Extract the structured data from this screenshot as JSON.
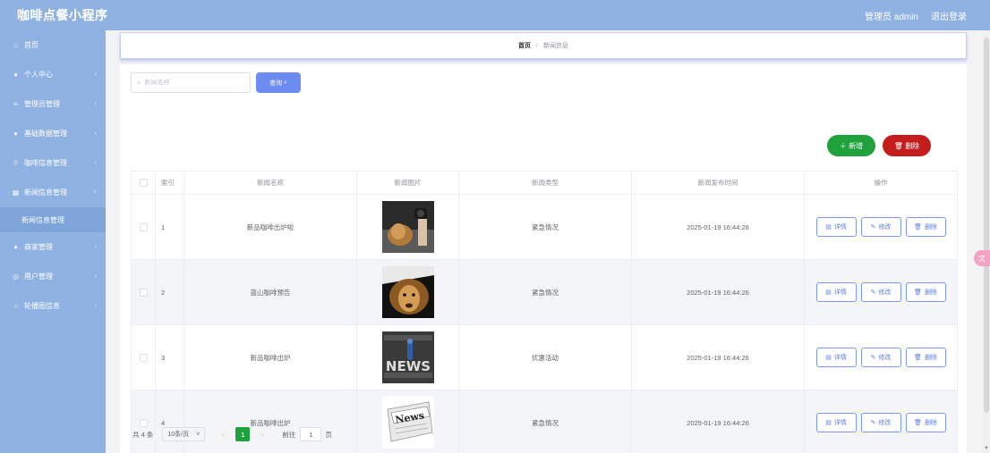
{
  "app": {
    "title": "咖啡点餐小程序"
  },
  "header": {
    "user_label": "管理员 admin",
    "logout_label": "退出登录"
  },
  "sidebar": {
    "items": [
      {
        "label": "首页",
        "icon": "home-icon"
      },
      {
        "label": "个人中心",
        "icon": "user-icon"
      },
      {
        "label": "管理员管理",
        "icon": "settings-icon"
      },
      {
        "label": "基础数据管理",
        "icon": "user-icon"
      },
      {
        "label": "咖啡信息管理",
        "icon": "cup-icon"
      },
      {
        "label": "新闻信息管理",
        "icon": "grid-icon"
      },
      {
        "label": "新闻信息管理",
        "icon": ""
      },
      {
        "label": "商家管理",
        "icon": "user-icon"
      },
      {
        "label": "用户管理",
        "icon": "circle-user-icon"
      },
      {
        "label": "轮播图信息",
        "icon": "circle-icon"
      }
    ]
  },
  "breadcrumb": {
    "home": "首页",
    "separator": "/",
    "current": "新闻信息"
  },
  "search": {
    "placeholder": "新闻名称",
    "value": "",
    "button_label": "查询"
  },
  "actions": {
    "add_label": "新增",
    "delete_label": "删除"
  },
  "table": {
    "headers": [
      "索引",
      "新闻名称",
      "新闻图片",
      "新闻类型",
      "新闻发布时间",
      "操作"
    ],
    "rows": [
      {
        "index": "1",
        "name": "新品咖啡出炉啦",
        "image": "lion-photo",
        "type": "紧急情况",
        "time": "2025-01-19 16:44:26"
      },
      {
        "index": "2",
        "name": "蓝山咖啡预告",
        "image": "lion-photo",
        "type": "紧急情况",
        "time": "2025-01-19 16:44:26"
      },
      {
        "index": "3",
        "name": "新品咖啡出炉",
        "image": "news-photo",
        "type": "优惠活动",
        "time": "2025-01-19 16:44:26"
      },
      {
        "index": "4",
        "name": "新品咖啡出炉",
        "image": "newspaper-photo",
        "type": "紧急情况",
        "time": "2025-01-19 16:44:26"
      }
    ],
    "op_labels": {
      "detail": "详情",
      "edit": "修改",
      "delete": "删除"
    }
  },
  "pagination": {
    "total_label": "共 4 条",
    "page_size": "10条/页",
    "current_page": "1",
    "goto_label": "前往",
    "goto_value": "1",
    "page_unit": "页"
  },
  "colors": {
    "sidebar": "#8fb2e3",
    "primary": "#6c8cf2",
    "success": "#1fa23b",
    "danger": "#c51d1d"
  }
}
